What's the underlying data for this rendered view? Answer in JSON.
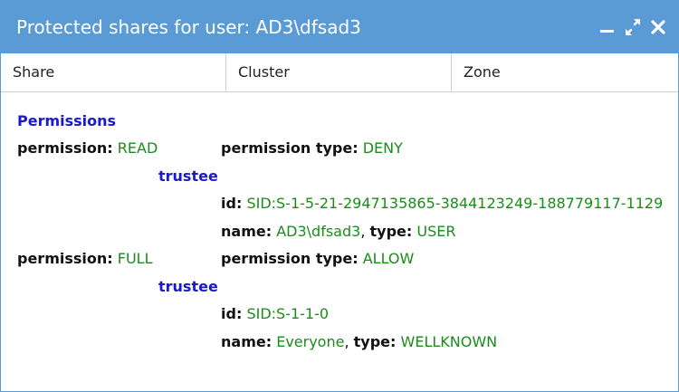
{
  "window": {
    "title": "Protected shares for user: AD3\\dfsad3",
    "colors": {
      "titlebar": "#5b9bd5",
      "key_text": "#111111",
      "value_text": "#1a8c1a",
      "section_text": "#1a1acc"
    },
    "buttons": {
      "minimize_icon": "minimize-icon",
      "maximize_icon": "maximize-icon",
      "close_icon": "close-icon"
    }
  },
  "table": {
    "columns": [
      "Share",
      "Cluster",
      "Zone"
    ]
  },
  "details": {
    "section_title": "Permissions",
    "trustee_label": "trustee",
    "permission_key": "permission:",
    "permission_type_key": "permission type:",
    "id_key": "id:",
    "name_key": "name:",
    "type_key": "type:",
    "comma": ",",
    "entries": [
      {
        "permission": "READ",
        "permission_type": "DENY",
        "trustee": {
          "id": "SID:S-1-5-21-2947135865-3844123249-188779117-1129",
          "name": "AD3\\dfsad3",
          "type": "USER"
        }
      },
      {
        "permission": "FULL",
        "permission_type": "ALLOW",
        "trustee": {
          "id": "SID:S-1-1-0",
          "name": "Everyone",
          "type": "WELLKNOWN"
        }
      }
    ]
  }
}
